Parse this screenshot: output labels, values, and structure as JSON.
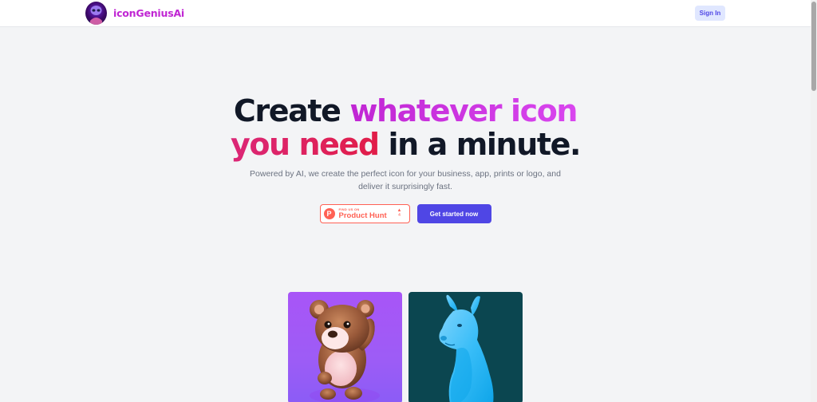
{
  "navbar": {
    "brand_name": "iconGeniusAi",
    "sign_in_label": "Sign In"
  },
  "hero": {
    "headline_part1": "Create ",
    "headline_highlight1": "whatever icon",
    "headline_highlight2": "you need",
    "headline_part2": " in a minute.",
    "subtitle": "Powered by AI, we create the perfect icon for your business, app, prints or logo, and deliver it surprisingly fast."
  },
  "cta": {
    "product_hunt_small": "FIND US ON",
    "product_hunt_name": "Product Hunt",
    "product_hunt_letter": "P",
    "product_hunt_arrow": "▲",
    "product_hunt_count": "4",
    "get_started_label": "Get started now"
  },
  "colors": {
    "accent": "#4f46e5",
    "brand": "#c026d3",
    "highlight_pink": "#db2777",
    "product_hunt": "#ff6154"
  },
  "gallery": [
    {
      "icon": "teddy-bear-icon"
    },
    {
      "icon": "llama-icon"
    }
  ]
}
